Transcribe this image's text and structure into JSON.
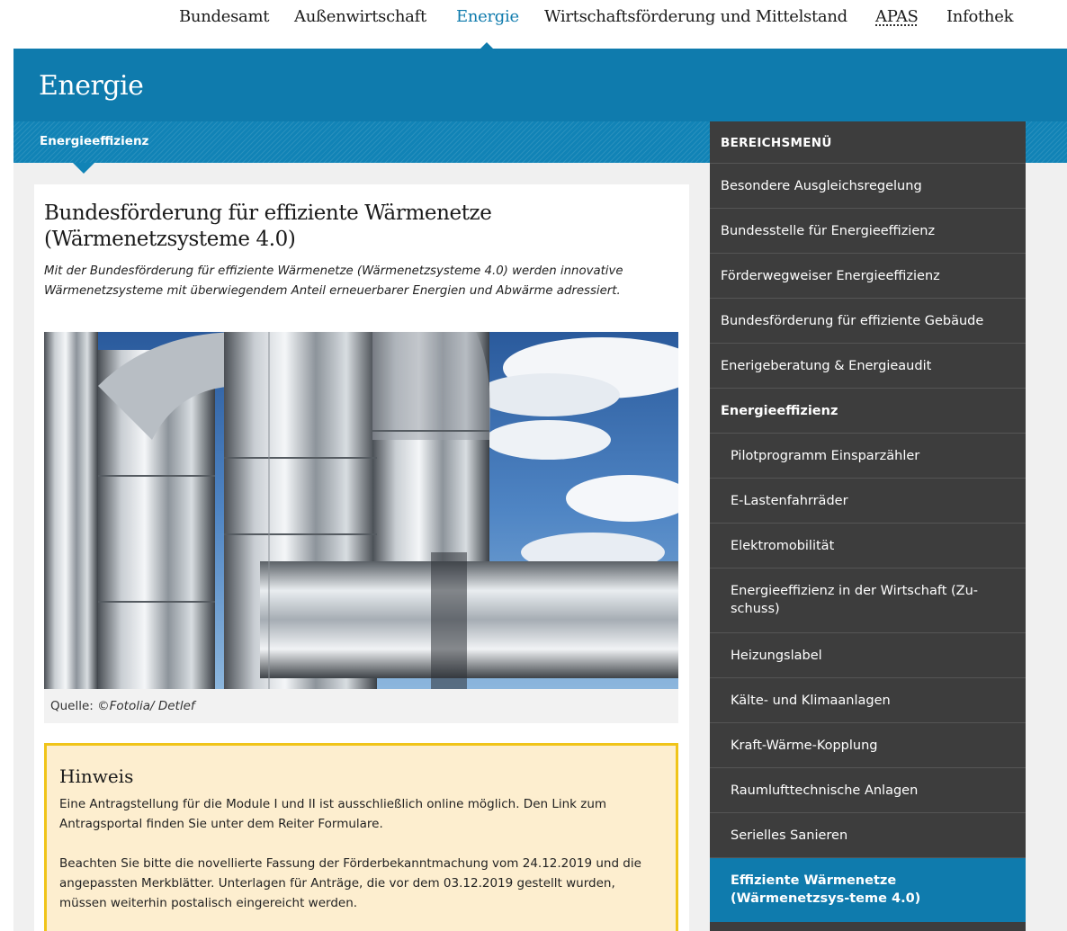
{
  "topnav": {
    "items": [
      {
        "label": "Bundesamt"
      },
      {
        "label": "Außenwirtschaft"
      },
      {
        "label": "Energie",
        "active": true
      },
      {
        "label": "Wirtschaftsförderung und Mittelstand"
      },
      {
        "label": "APAS"
      },
      {
        "label": "Infothek"
      }
    ]
  },
  "hero": {
    "title": "Energie"
  },
  "stripe": {
    "breadcrumb": "Energieeffizienz"
  },
  "article": {
    "title": "Bundesförderung für effiziente Wärmenetze (Wärmenetzsysteme 4.0)",
    "lead": "Mit der Bundesförderung für effiziente Wärmenetze (Wärmenetzsysteme 4.0) werden innovative Wärmenetzsysteme mit überwiegendem Anteil erneuerbarer Energien und Abwärme adressiert.",
    "caption_prefix": "Quelle: ",
    "caption_source": "©Fotolia/ Detlef"
  },
  "hint": {
    "title": "Hinweis",
    "p1": "Eine Antragstellung für die Module I und II ist ausschließlich online möglich. Den Link zum Antragsportal finden Sie unter dem Reiter Formulare.",
    "p2": "Beachten Sie bitte die novellierte Fassung der Förderbekanntmachung vom 24.12.2019 und die angepassten Merkblätter. Unterlagen für Anträge, die vor dem 03.12.2019 gestellt wurden, müssen weiterhin postalisch eingereicht werden."
  },
  "sidebar": {
    "heading": "BEREICHSMENÜ",
    "items": [
      {
        "label": "Besondere Ausgleichsregelung"
      },
      {
        "label": "Bundesstelle für Energieeffizienz"
      },
      {
        "label": "Förderwegweiser Energieeffizienz"
      },
      {
        "label": "Bundesförderung für effiziente Gebäude"
      },
      {
        "label": "Enerigeberatung & Energieaudit"
      },
      {
        "label": "Energieeffizienz"
      },
      {
        "label": "Pilotprogramm Einsparzähler"
      },
      {
        "label": "E-Lastenfahrräder"
      },
      {
        "label": "Elektromobilität"
      },
      {
        "label": "Energieeffizienz in der Wirtschaft (Zu-schuss)"
      },
      {
        "label": "Heizungslabel"
      },
      {
        "label": "Kälte- und Klimaanlagen"
      },
      {
        "label": "Kraft-Wärme-Kopplung"
      },
      {
        "label": "Raumlufttechnische Anlagen"
      },
      {
        "label": "Serielles Sanieren"
      },
      {
        "label": "Effiziente Wärmenetze (Wärmenetzsys-teme 4.0)"
      }
    ]
  },
  "colors": {
    "brand_blue": "#0f7bad",
    "sidebar_bg": "#3d3d3d",
    "hint_bg": "#fdeecf",
    "hint_border": "#f0c419"
  }
}
